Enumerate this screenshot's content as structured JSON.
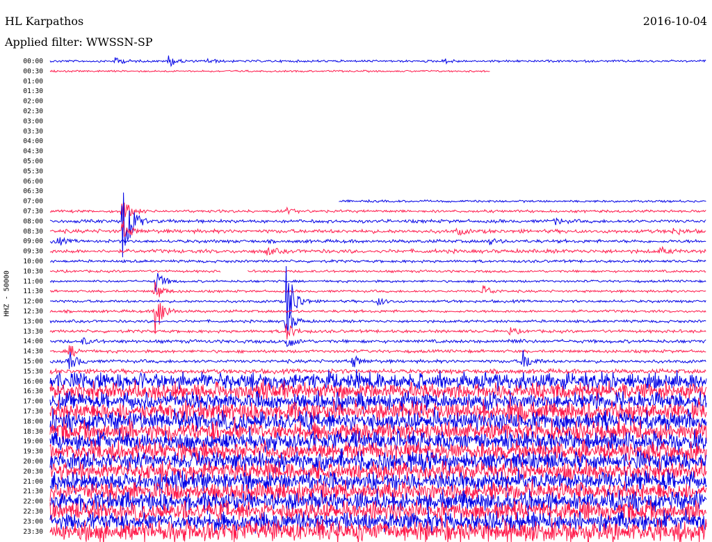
{
  "header": {
    "station": "HL Karpathos",
    "date": "2016-10-04",
    "filter": "Applied filter: WWSSN-SP"
  },
  "chart_data": {
    "type": "line",
    "title": "HL Karpathos",
    "subtitle": "Applied filter: WWSSN-SP",
    "ylabel": "HHZ - 50000",
    "trace_colors": [
      "#0000e6",
      "#ff1a4b"
    ],
    "y_tick_labels": [
      "00:00",
      "00:30",
      "01:00",
      "01:30",
      "02:00",
      "02:30",
      "03:00",
      "03:30",
      "04:00",
      "04:30",
      "05:00",
      "05:30",
      "06:00",
      "06:30",
      "07:00",
      "07:30",
      "08:00",
      "08:30",
      "09:00",
      "09:30",
      "10:00",
      "10:30",
      "11:00",
      "11:30",
      "12:00",
      "12:30",
      "13:00",
      "13:30",
      "14:00",
      "14:30",
      "15:00",
      "15:30",
      "16:00",
      "16:30",
      "17:00",
      "17:30",
      "18:00",
      "18:30",
      "19:00",
      "19:30",
      "20:00",
      "20:30",
      "21:00",
      "21:30",
      "22:00",
      "22:30",
      "23:00",
      "23:30"
    ],
    "rows": [
      {
        "t": "00:00",
        "start": 0.0,
        "end": 1.0,
        "noise": 1.5,
        "events": [
          {
            "at": 0.1,
            "amp": 6
          },
          {
            "at": 0.18,
            "amp": 10
          },
          {
            "at": 0.24,
            "amp": 4
          },
          {
            "at": 0.6,
            "amp": 4
          }
        ]
      },
      {
        "t": "00:30",
        "start": 0.0,
        "end": 0.67,
        "noise": 1.2,
        "events": []
      },
      {
        "t": "01:00",
        "start": null,
        "end": null,
        "noise": 0,
        "events": []
      },
      {
        "t": "01:30",
        "start": null,
        "end": null,
        "noise": 0,
        "events": []
      },
      {
        "t": "02:00",
        "start": null,
        "end": null,
        "noise": 0,
        "events": []
      },
      {
        "t": "02:30",
        "start": null,
        "end": null,
        "noise": 0,
        "events": []
      },
      {
        "t": "03:00",
        "start": null,
        "end": null,
        "noise": 0,
        "events": []
      },
      {
        "t": "03:30",
        "start": null,
        "end": null,
        "noise": 0,
        "events": []
      },
      {
        "t": "04:00",
        "start": null,
        "end": null,
        "noise": 0,
        "events": []
      },
      {
        "t": "04:30",
        "start": null,
        "end": null,
        "noise": 0,
        "events": []
      },
      {
        "t": "05:00",
        "start": null,
        "end": null,
        "noise": 0,
        "events": []
      },
      {
        "t": "05:30",
        "start": null,
        "end": null,
        "noise": 0,
        "events": []
      },
      {
        "t": "06:00",
        "start": null,
        "end": null,
        "noise": 0,
        "events": []
      },
      {
        "t": "06:30",
        "start": null,
        "end": null,
        "noise": 0,
        "events": []
      },
      {
        "t": "07:00",
        "start": 0.44,
        "end": 1.0,
        "noise": 1.5,
        "events": []
      },
      {
        "t": "07:30",
        "start": 0.0,
        "end": 1.0,
        "noise": 1.8,
        "events": [
          {
            "at": 0.11,
            "amp": 20
          },
          {
            "at": 0.36,
            "amp": 4
          }
        ]
      },
      {
        "t": "08:00",
        "start": 0.0,
        "end": 1.0,
        "noise": 2.2,
        "events": [
          {
            "at": 0.11,
            "amp": 90
          },
          {
            "at": 0.77,
            "amp": 5
          }
        ]
      },
      {
        "t": "08:30",
        "start": 0.0,
        "end": 1.0,
        "noise": 2.5,
        "events": [
          {
            "at": 0.11,
            "amp": 15
          },
          {
            "at": 0.62,
            "amp": 5
          },
          {
            "at": 0.95,
            "amp": 5
          }
        ]
      },
      {
        "t": "09:00",
        "start": 0.0,
        "end": 1.0,
        "noise": 2.2,
        "events": [
          {
            "at": 0.01,
            "amp": 6
          },
          {
            "at": 0.67,
            "amp": 4
          }
        ]
      },
      {
        "t": "09:30",
        "start": 0.0,
        "end": 1.0,
        "noise": 2.5,
        "events": [
          {
            "at": 0.33,
            "amp": 6
          },
          {
            "at": 0.93,
            "amp": 5
          }
        ]
      },
      {
        "t": "10:00",
        "start": 0.0,
        "end": 1.0,
        "noise": 1.8,
        "events": []
      },
      {
        "t": "10:30",
        "start": 0.0,
        "end": 1.0,
        "noise": 1.6,
        "events": [],
        "gap": [
          0.26,
          0.3
        ]
      },
      {
        "t": "11:00",
        "start": 0.0,
        "end": 1.0,
        "noise": 1.6,
        "events": [
          {
            "at": 0.16,
            "amp": 18
          }
        ]
      },
      {
        "t": "11:30",
        "start": 0.0,
        "end": 1.0,
        "noise": 1.6,
        "events": [
          {
            "at": 0.16,
            "amp": 15
          },
          {
            "at": 0.66,
            "amp": 10
          }
        ]
      },
      {
        "t": "12:00",
        "start": 0.0,
        "end": 1.0,
        "noise": 1.8,
        "events": [
          {
            "at": 0.36,
            "amp": 60
          },
          {
            "at": 0.5,
            "amp": 6
          }
        ]
      },
      {
        "t": "12:30",
        "start": 0.0,
        "end": 1.0,
        "noise": 1.8,
        "events": [
          {
            "at": 0.16,
            "amp": 40
          }
        ]
      },
      {
        "t": "13:00",
        "start": 0.0,
        "end": 1.0,
        "noise": 1.8,
        "events": [
          {
            "at": 0.36,
            "amp": 22
          }
        ]
      },
      {
        "t": "13:30",
        "start": 0.0,
        "end": 1.0,
        "noise": 2.0,
        "events": [
          {
            "at": 0.36,
            "amp": 14
          },
          {
            "at": 0.7,
            "amp": 5
          }
        ]
      },
      {
        "t": "14:00",
        "start": 0.0,
        "end": 1.0,
        "noise": 2.2,
        "events": [
          {
            "at": 0.36,
            "amp": 12
          },
          {
            "at": 0.05,
            "amp": 5
          },
          {
            "at": 0.7,
            "amp": 5
          }
        ]
      },
      {
        "t": "14:30",
        "start": 0.0,
        "end": 1.0,
        "noise": 2.0,
        "events": [
          {
            "at": 0.03,
            "amp": 10
          }
        ]
      },
      {
        "t": "15:00",
        "start": 0.0,
        "end": 1.0,
        "noise": 2.2,
        "events": [
          {
            "at": 0.03,
            "amp": 14
          },
          {
            "at": 0.46,
            "amp": 10
          },
          {
            "at": 0.72,
            "amp": 16
          }
        ]
      },
      {
        "t": "15:30",
        "start": 0.0,
        "end": 1.0,
        "noise": 3.0,
        "events": []
      },
      {
        "t": "16:00",
        "start": 0.0,
        "end": 1.0,
        "noise": 9,
        "events": []
      },
      {
        "t": "16:30",
        "start": 0.0,
        "end": 1.0,
        "noise": 9,
        "events": []
      },
      {
        "t": "17:00",
        "start": 0.0,
        "end": 1.0,
        "noise": 9,
        "events": []
      },
      {
        "t": "17:30",
        "start": 0.0,
        "end": 1.0,
        "noise": 10,
        "events": [
          {
            "at": 0.7,
            "amp": 16
          }
        ]
      },
      {
        "t": "18:00",
        "start": 0.0,
        "end": 1.0,
        "noise": 10,
        "events": []
      },
      {
        "t": "18:30",
        "start": 0.0,
        "end": 1.0,
        "noise": 10,
        "events": []
      },
      {
        "t": "19:00",
        "start": 0.0,
        "end": 1.0,
        "noise": 10,
        "events": []
      },
      {
        "t": "19:30",
        "start": 0.0,
        "end": 1.0,
        "noise": 10,
        "events": []
      },
      {
        "t": "20:00",
        "start": 0.0,
        "end": 1.0,
        "noise": 10,
        "events": []
      },
      {
        "t": "20:30",
        "start": 0.0,
        "end": 1.0,
        "noise": 10,
        "events": []
      },
      {
        "t": "21:00",
        "start": 0.0,
        "end": 1.0,
        "noise": 10,
        "events": []
      },
      {
        "t": "21:30",
        "start": 0.0,
        "end": 1.0,
        "noise": 10,
        "events": []
      },
      {
        "t": "22:00",
        "start": 0.0,
        "end": 1.0,
        "noise": 10,
        "events": []
      },
      {
        "t": "22:30",
        "start": 0.0,
        "end": 1.0,
        "noise": 10,
        "events": []
      },
      {
        "t": "23:00",
        "start": 0.0,
        "end": 1.0,
        "noise": 10,
        "events": []
      },
      {
        "t": "23:30",
        "start": 0.0,
        "end": 1.0,
        "noise": 11,
        "events": []
      }
    ]
  }
}
